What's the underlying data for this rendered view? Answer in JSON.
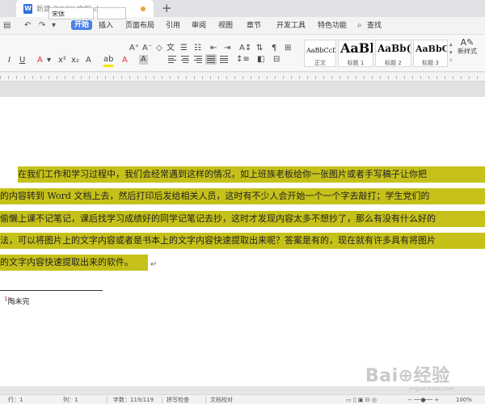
{
  "window": {
    "tab_title": "新建 DOCX 文档.docx",
    "new_tab": "+"
  },
  "menu": {
    "items": [
      {
        "label": "开始",
        "active": true
      },
      {
        "label": "插入"
      },
      {
        "label": "页面布局"
      },
      {
        "label": "引用"
      },
      {
        "label": "审阅"
      },
      {
        "label": "视图"
      },
      {
        "label": "章节"
      },
      {
        "label": "开发工具"
      },
      {
        "label": "特色功能"
      },
      {
        "label": "查找"
      }
    ]
  },
  "ribbon": {
    "font_name": "宋体",
    "styles": [
      {
        "sample": "AaBbCcDd",
        "name": "正文"
      },
      {
        "sample": "AaBl",
        "name": "标题 1"
      },
      {
        "sample": "AaBb(",
        "name": "标题 2"
      },
      {
        "sample": "AaBbC",
        "name": "标题 3"
      }
    ],
    "new_style": "新样式",
    "highlight_color": "#f2e600",
    "font_color": "#dd2222"
  },
  "document": {
    "highlight_color": "#c6c11a",
    "lines": [
      "在我们工作和学习过程中，我们会经常遇到这样的情况，如上班族老板给你一张图片或者手写稿子让你把",
      "的内容转到 Word 文档上去，然后打印后发给相关人员，这时有不少人会开始一个一个字去敲打；学生党们的",
      "偷懒上课不记笔记，课后找学习成绩好的同学记笔记去抄，这时才发现内容太多不想抄了，那么有没有什么好的",
      "法，可以将图片上的文字内容或者是书本上的文字内容快速提取出来呢？答案是有的，现在就有许多具有将图片",
      "的文字内容快速提取出来的软件。"
    ],
    "footnote": "陶未完"
  },
  "watermark": {
    "text": "Bai⊕经验",
    "sub": "jingyan.baidu.com"
  },
  "status": {
    "items": [
      "行：1",
      "列：1",
      "字数：119/119",
      "拼写检查",
      "文档校对"
    ],
    "zoom": "100%"
  }
}
